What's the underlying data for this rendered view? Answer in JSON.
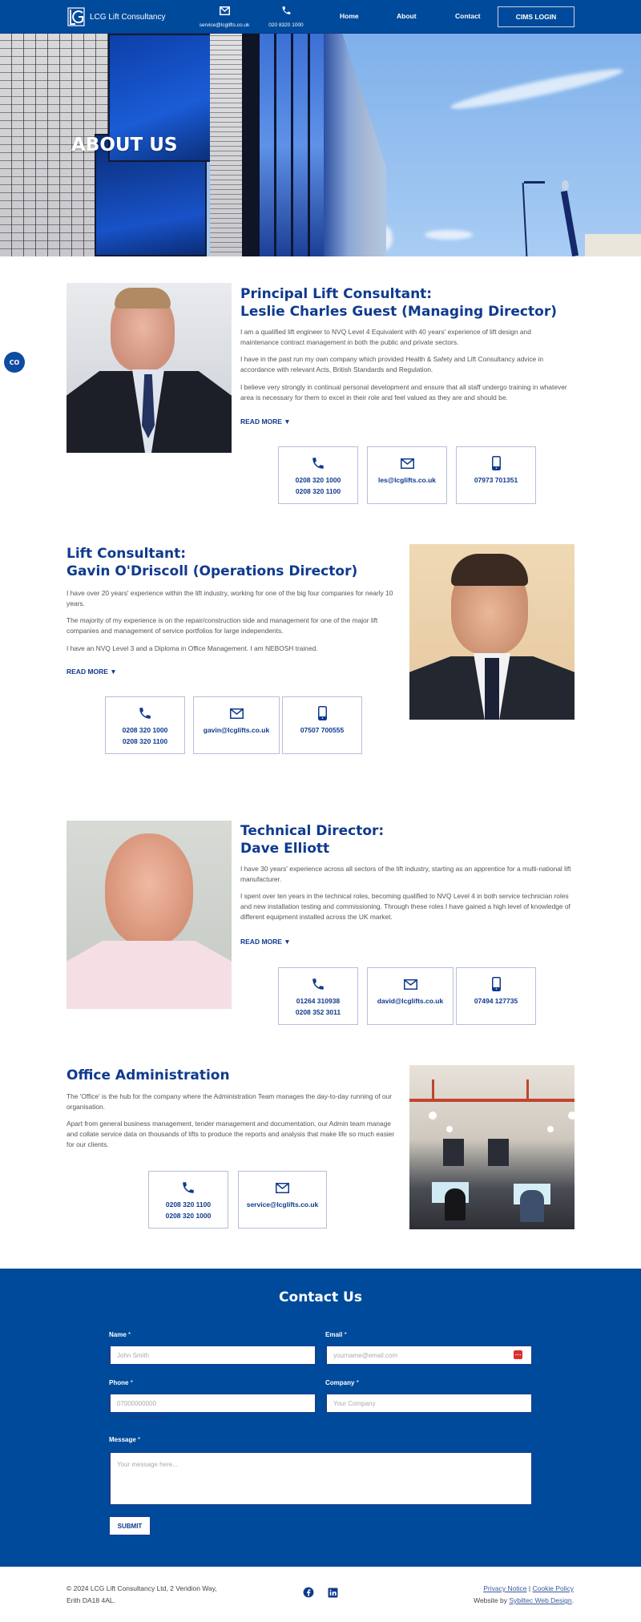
{
  "header": {
    "brand": "LCG Lift Consultancy",
    "email_label": "service@lcglifts.co.uk",
    "phone_label": "020 8320 1000",
    "nav": [
      {
        "label": "Home"
      },
      {
        "label": "About"
      },
      {
        "label": "Contact"
      }
    ],
    "cims_label": "CIMS LOGIN"
  },
  "hero": {
    "title": "ABOUT US"
  },
  "accessibility": {
    "label": "CO"
  },
  "people": [
    {
      "title_line1": "Principal Lift Consultant:",
      "title_line2": "Leslie Charles Guest (Managing Director)",
      "paragraphs": [
        "I am a qualified lift engineer to NVQ Level 4 Equivalent with 40 years' experience of lift design and maintenance contract management in both the public and private sectors.",
        "I have in the past run my own company which provided Health & Safety and Lift Consultancy advice in accordance with relevant Acts, British Standards and Regulation.",
        "I believe very strongly in continual personal development and ensure that all staff undergo training in whatever area is necessary for them to excel in their role and feel valued as they are and should be."
      ],
      "read_more": "READ MORE ▼",
      "phones": [
        "0208 320 1000",
        "0208 320 1100"
      ],
      "email": "les@lcglifts.co.uk",
      "mobile": "07973 701351"
    },
    {
      "title_line1": "Lift Consultant:",
      "title_line2": "Gavin O'Driscoll (Operations Director)",
      "paragraphs": [
        "I have over 20 years' experience within the lift industry, working for one of the big four companies for nearly 10 years.",
        "The majority of my experience is on the repair/construction side and management for one of the major lift companies and management of service portfolios for large independents.",
        "I have an NVQ Level 3 and a Diploma in Office Management. I am NEBOSH trained."
      ],
      "read_more": "READ MORE ▼",
      "phones": [
        "0208 320 1000",
        "0208 320 1100"
      ],
      "email": "gavin@lcglifts.co.uk",
      "mobile": "07507 700555"
    },
    {
      "title_line1": "Technical Director:",
      "title_line2": "Dave Elliott",
      "paragraphs": [
        "I have 30 years' experience across all sectors of the lift industry, starting as an apprentice for a multi-national lift manufacturer.",
        "I spent over ten years in the technical roles, becoming qualified to NVQ Level 4 in both service technician roles and new installation testing and commissioning. Through these roles I have gained a high level of knowledge of different equipment installed across the UK market."
      ],
      "read_more": "READ MORE ▼",
      "phones": [
        "01264 310938",
        "0208 352 3011"
      ],
      "email": "david@lcglifts.co.uk",
      "mobile": "07494 127735"
    }
  ],
  "office": {
    "title": "Office Administration",
    "paragraphs": [
      "The 'Office' is the hub for the company where the Administration Team manages the day-to-day running of our organisation.",
      "Apart from general business management, tender management and documentation, our Admin team manage and collate service data on thousands of lifts to produce the reports and analysis that make life so much easier for our clients."
    ],
    "phones": [
      "0208 320 1100",
      "0208 320 1000"
    ],
    "email": "service@lcglifts.co.uk"
  },
  "contact_form": {
    "title": "Contact Us",
    "name_label": "Name",
    "email_label": "Email",
    "phone_label": "Phone",
    "company_label": "Company",
    "message_label": "Message",
    "required_mark": "*",
    "name_placeholder": "John Smith",
    "email_placeholder": "yourname@email.com",
    "phone_placeholder": "07000000000",
    "company_placeholder": "Your Company",
    "message_placeholder": "Your message here...",
    "phone_hint": "0 of 15 max characters.",
    "submit_label": "SUBMIT"
  },
  "footer": {
    "copyright_line1": "© 2024 LCG Lift Consultancy Ltd, 2 Veridion Way,",
    "copyright_line2": "Erith DA18 4AL.",
    "privacy_label": "Privacy Notice",
    "separator": "|",
    "cookie_label": "Cookie Policy",
    "website_by_prefix": "Website by ",
    "website_by_link": "Sybiltec Web Design",
    "website_by_suffix": "."
  },
  "colors": {
    "brand_blue": "#004a9b",
    "heading_blue": "#0f3a8e",
    "card_border": "#b6bfd9",
    "password_icon": "#d9302f"
  }
}
